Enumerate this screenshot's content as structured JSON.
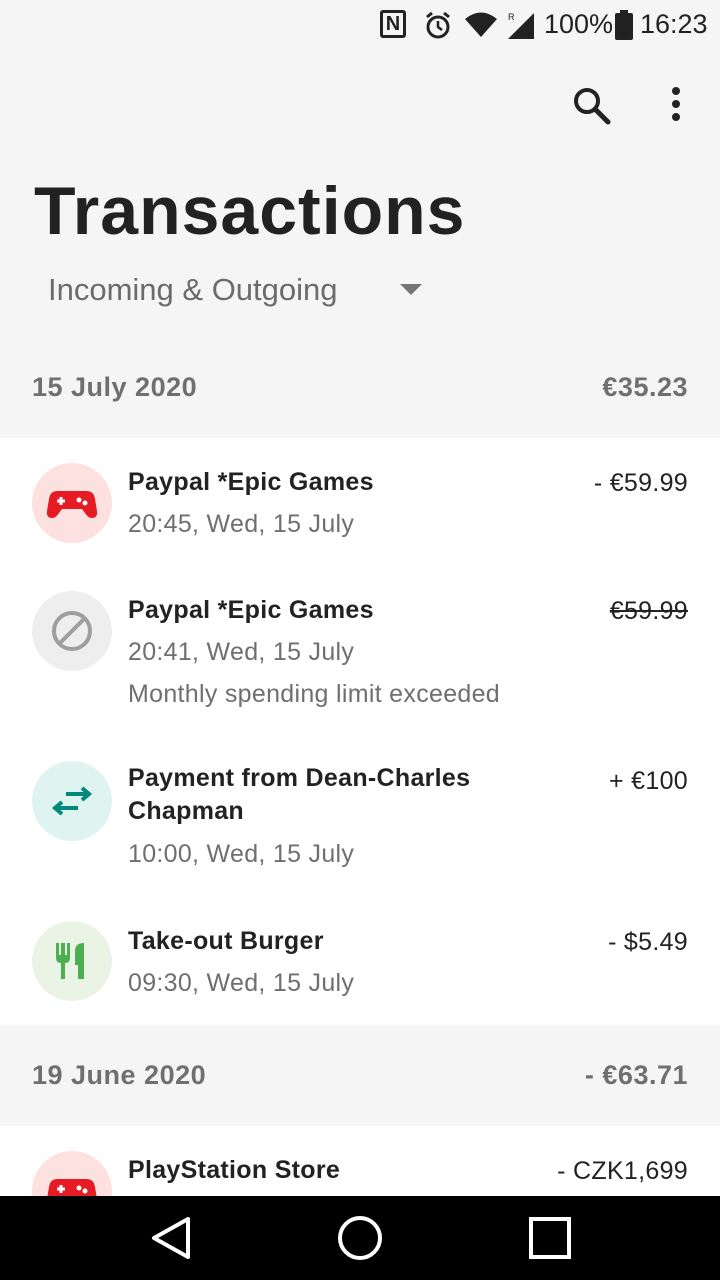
{
  "status_bar": {
    "nfc": "N",
    "battery_percent": "100%",
    "time": "16:23",
    "icons": [
      "nfc-icon",
      "alarm-icon",
      "wifi-icon",
      "signal-icon",
      "battery-icon"
    ]
  },
  "toolbar": {
    "icons": [
      "search-icon",
      "more-vert-icon"
    ]
  },
  "page": {
    "title": "Transactions"
  },
  "filter": {
    "selected": "Incoming & Outgoing",
    "icon": "dropdown-caret-icon"
  },
  "groups": [
    {
      "date": "15 July 2020",
      "total": "€35.23",
      "transactions": [
        {
          "name": "Paypal *Epic Games",
          "time": "20:45, Wed, 15 July",
          "amount": "- €59.99",
          "icon": "gamepad-icon",
          "icon_bg": "#fde0e0",
          "icon_color": "#e51c23"
        },
        {
          "name": "Paypal *Epic Games",
          "time": "20:41, Wed, 15 July",
          "note": "Monthly spending limit exceeded",
          "amount": "€59.99",
          "declined": true,
          "icon": "block-icon",
          "icon_bg": "#eeeeee",
          "icon_color": "#9e9e9e"
        },
        {
          "name": "Payment from Dean-Charles Chapman",
          "time": "10:00, Wed, 15 July",
          "amount": "+ €100",
          "icon": "transfer-arrows-icon",
          "icon_bg": "#dff3f1",
          "icon_color": "#00897b"
        },
        {
          "name": "Take-out Burger",
          "time": "09:30, Wed, 15 July",
          "amount": "- $5.49",
          "icon": "restaurant-icon",
          "icon_bg": "#eaf4e4",
          "icon_color": "#4caf50"
        }
      ]
    },
    {
      "date": "19 June 2020",
      "total": "- €63.71",
      "transactions": [
        {
          "name": "PlayStation Store",
          "amount": "- CZK1,699",
          "icon": "gamepad-icon",
          "icon_bg": "#fde0e0",
          "icon_color": "#e51c23"
        }
      ]
    }
  ],
  "nav_bar": {
    "icons": [
      "back-icon",
      "home-icon",
      "recents-icon"
    ]
  }
}
